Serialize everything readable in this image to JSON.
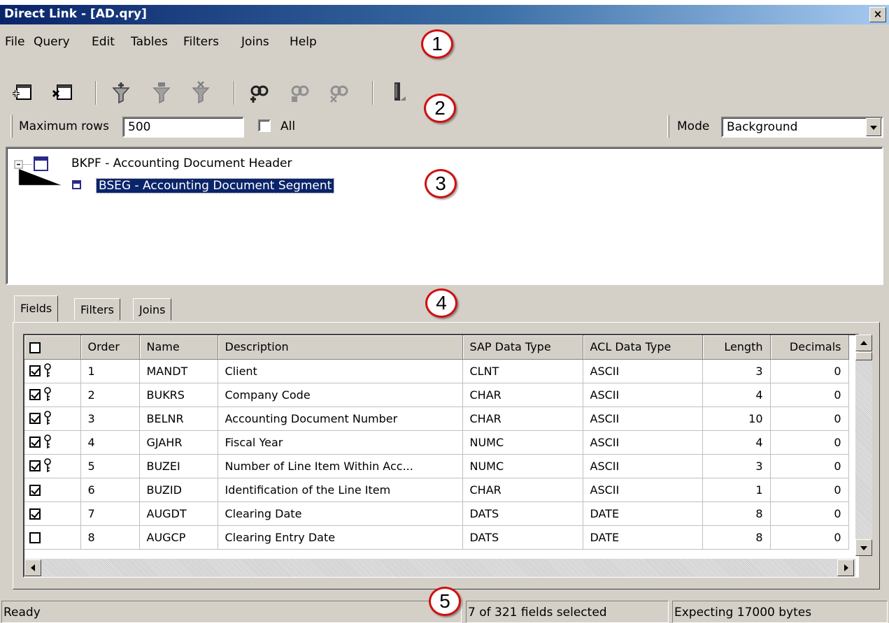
{
  "window": {
    "title": "Direct Link - [AD.qry]",
    "close_label": "×"
  },
  "menu": [
    "File",
    "Query",
    "Edit",
    "Tables",
    "Filters",
    "Joins",
    "Help"
  ],
  "toolbar": {
    "buttons": [
      "add-table-icon",
      "remove-table-icon",
      "add-filter-icon",
      "edit-filter-icon",
      "remove-filter-icon",
      "add-join-icon",
      "edit-join-icon",
      "remove-join-icon",
      "run-query-icon"
    ]
  },
  "options": {
    "max_rows_label": "Maximum rows",
    "max_rows_value": "500",
    "all_label": "All",
    "all_checked": false,
    "mode_label": "Mode",
    "mode_value": "Background"
  },
  "tree": {
    "parent": "BKPF - Accounting Document Header",
    "child": "BSEG - Accounting Document Segment"
  },
  "tabs": [
    "Fields",
    "Filters",
    "Joins"
  ],
  "active_tab": "Fields",
  "grid": {
    "columns": [
      "Order",
      "Name",
      "Description",
      "SAP Data Type",
      "ACL Data Type",
      "Length",
      "Decimals"
    ],
    "rows": [
      {
        "checked": true,
        "key": true,
        "order": "1",
        "name": "MANDT",
        "description": "Client",
        "sap": "CLNT",
        "acl": "ASCII",
        "length": "3",
        "decimals": "0"
      },
      {
        "checked": true,
        "key": true,
        "order": "2",
        "name": "BUKRS",
        "description": "Company Code",
        "sap": "CHAR",
        "acl": "ASCII",
        "length": "4",
        "decimals": "0"
      },
      {
        "checked": true,
        "key": true,
        "order": "3",
        "name": "BELNR",
        "description": "Accounting Document Number",
        "sap": "CHAR",
        "acl": "ASCII",
        "length": "10",
        "decimals": "0"
      },
      {
        "checked": true,
        "key": true,
        "order": "4",
        "name": "GJAHR",
        "description": "Fiscal Year",
        "sap": "NUMC",
        "acl": "ASCII",
        "length": "4",
        "decimals": "0"
      },
      {
        "checked": true,
        "key": true,
        "order": "5",
        "name": "BUZEI",
        "description": "Number of Line Item Within Acc...",
        "sap": "NUMC",
        "acl": "ASCII",
        "length": "3",
        "decimals": "0"
      },
      {
        "checked": true,
        "key": false,
        "order": "6",
        "name": "BUZID",
        "description": "Identification of the Line Item",
        "sap": "CHAR",
        "acl": "ASCII",
        "length": "1",
        "decimals": "0"
      },
      {
        "checked": true,
        "key": false,
        "order": "7",
        "name": "AUGDT",
        "description": "Clearing Date",
        "sap": "DATS",
        "acl": "DATE",
        "length": "8",
        "decimals": "0"
      },
      {
        "checked": false,
        "key": false,
        "order": "8",
        "name": "AUGCP",
        "description": "Clearing Entry Date",
        "sap": "DATS",
        "acl": "DATE",
        "length": "8",
        "decimals": "0"
      }
    ]
  },
  "status": {
    "left": "Ready",
    "middle": "7 of 321 fields selected",
    "right": "Expecting 17000 bytes"
  },
  "callouts": [
    "1",
    "2",
    "3",
    "4",
    "5"
  ],
  "colors": {
    "titlebar_start": "#0a246a",
    "selection": "#0a246a",
    "callout_border": "#d01010",
    "face": "#d4d0c8"
  }
}
